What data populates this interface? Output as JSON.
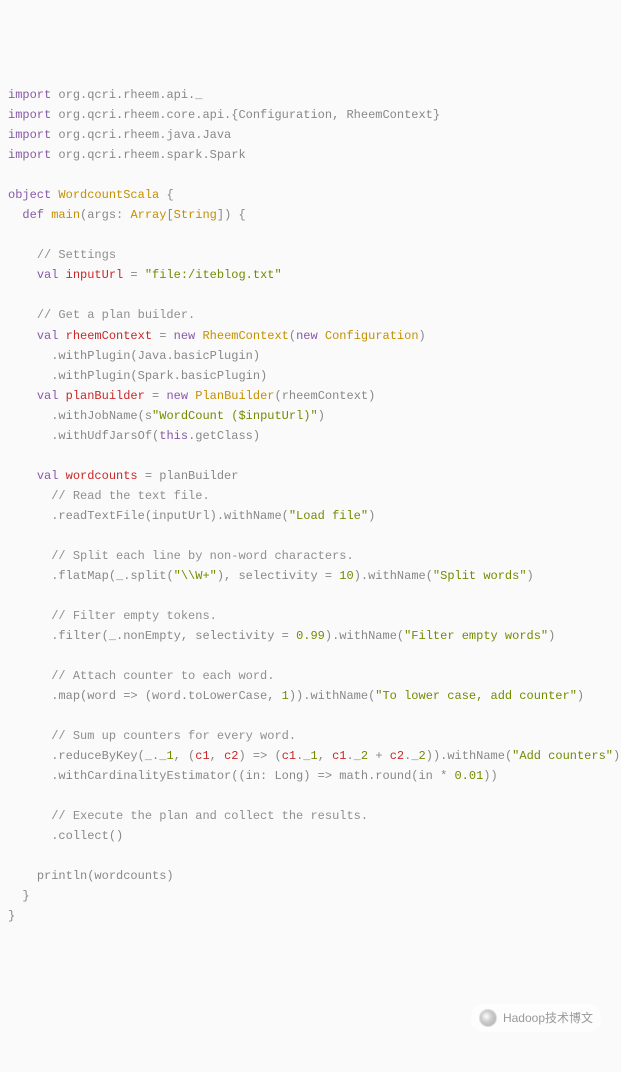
{
  "code": {
    "imports": [
      {
        "pkg": "org.qcri.rheem.api._"
      },
      {
        "pkg": "org.qcri.rheem.core.api.{Configuration, RheemContext}"
      },
      {
        "pkg": "org.qcri.rheem.java.Java"
      },
      {
        "pkg": "org.qcri.rheem.spark.Spark"
      }
    ],
    "object_name": "WordcountScala",
    "main_sig": "main(args: Array[String]) {",
    "settings_comment": "// Settings",
    "inputUrl_name": "inputUrl",
    "inputUrl_val": "\"file:/iteblog.txt\"",
    "get_builder_comment": "// Get a plan builder.",
    "rheemContext_name": "rheemContext",
    "rheemContext_new": "RheemContext",
    "configuration": "Configuration",
    "withPlugin_java": ".withPlugin(Java.basicPlugin)",
    "withPlugin_spark": ".withPlugin(Spark.basicPlugin)",
    "planBuilder_name": "planBuilder",
    "planBuilder_new": "PlanBuilder",
    "planBuilder_arg": "rheemContext",
    "withJobName_prefix": ".withJobName(s",
    "withJobName_str": "\"WordCount ($inputUrl)\"",
    "withUdfJarsOf": ".withUdfJarsOf(",
    "this_kw": "this",
    "getClass": ".getClass)",
    "wordcounts_name": "wordcounts",
    "wordcounts_rhs": "planBuilder",
    "read_comment": "// Read the text file.",
    "readTextFile": ".readTextFile(inputUrl).withName(",
    "loadfile_str": "\"Load file\"",
    "split_comment": "// Split each line by non-word characters.",
    "flatMap_pre": ".flatMap(_.split(",
    "regex_str": "\"\\\\W+\"",
    "selectivity_kw": "selectivity",
    "ten": "10",
    "splitwords_str": "\"Split words\"",
    "filter_comment": "// Filter empty tokens.",
    "filter_pre": ".filter(_.nonEmpty, ",
    "zero99": "0.99",
    "filterempty_str": "\"Filter empty words\"",
    "attach_comment": "// Attach counter to each word.",
    "map_pre": ".map(word => (word.toLowerCase, ",
    "one": "1",
    "tolower_str": "\"To lower case, add counter\"",
    "sum_comment": "// Sum up counters for every word.",
    "reduceByKey_pre": ".reduceByKey(_._",
    "r1": "1",
    "c1": "c1",
    "c2": "c2",
    "addcounters_str": "\"Add counters\"",
    "withCardEst": ".withCardinalityEstimator((in: Long) => math.round(in * ",
    "zero01": "0.01",
    "exec_comment": "// Execute the plan and collect the results.",
    "collect": ".collect()",
    "println": "println(wordcounts)"
  },
  "watermark": "Hadoop技术博文"
}
